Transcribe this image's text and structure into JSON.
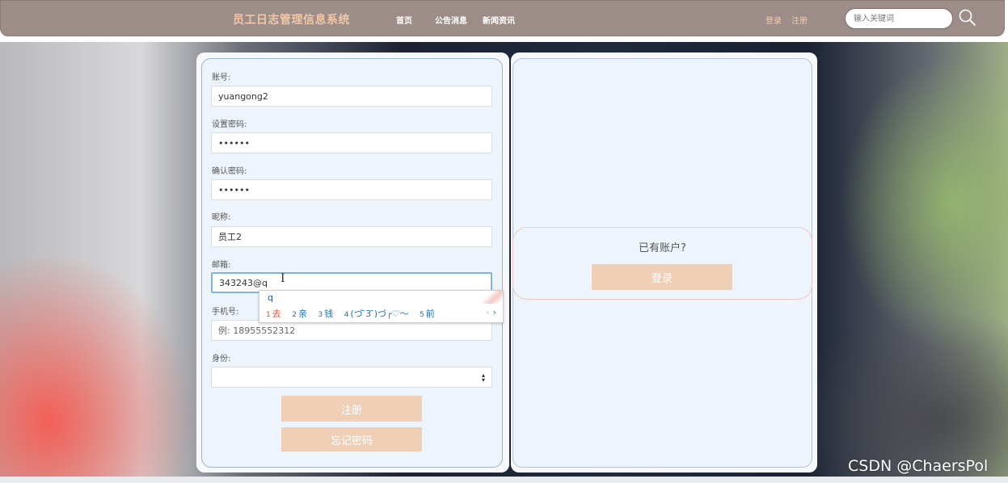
{
  "nav": {
    "title": "员工日志管理信息系统",
    "links": [
      "首页",
      "公告消息",
      "新闻资讯"
    ],
    "login": "登录",
    "register": "注册",
    "search_placeholder": "输入关键词"
  },
  "form": {
    "fields": [
      {
        "label": "账号:",
        "value": "yuangong2"
      },
      {
        "label": "设置密码:",
        "value": "••••••"
      },
      {
        "label": "确认密码:",
        "value": "••••••"
      },
      {
        "label": "昵称:",
        "value": "员工2"
      },
      {
        "label": "邮箱:",
        "value": "343243@q"
      },
      {
        "label": "手机号:",
        "placeholder": "例: 18955552312"
      },
      {
        "label": "身份:",
        "value": ""
      }
    ],
    "register_button": "注册",
    "forgot_button": "忘记密码"
  },
  "ime": {
    "composition": "q",
    "candidates": [
      {
        "num": "1",
        "text": "去"
      },
      {
        "num": "2",
        "text": "亲"
      },
      {
        "num": "3",
        "text": "钱"
      },
      {
        "num": "4",
        "text": "(づ ̄3 ̄)づ╭♡～"
      },
      {
        "num": "5",
        "text": "前"
      }
    ],
    "prev": "‹",
    "next": "›"
  },
  "side": {
    "have_account": "已有账户?",
    "login_button": "登录"
  },
  "watermark": "CSDN @ChaersPol",
  "colors": {
    "nav_bg": "#9c8d88",
    "title": "#f2c7a8",
    "button_bg": "#efcfb6",
    "panel_bg": "#eef4fc"
  }
}
